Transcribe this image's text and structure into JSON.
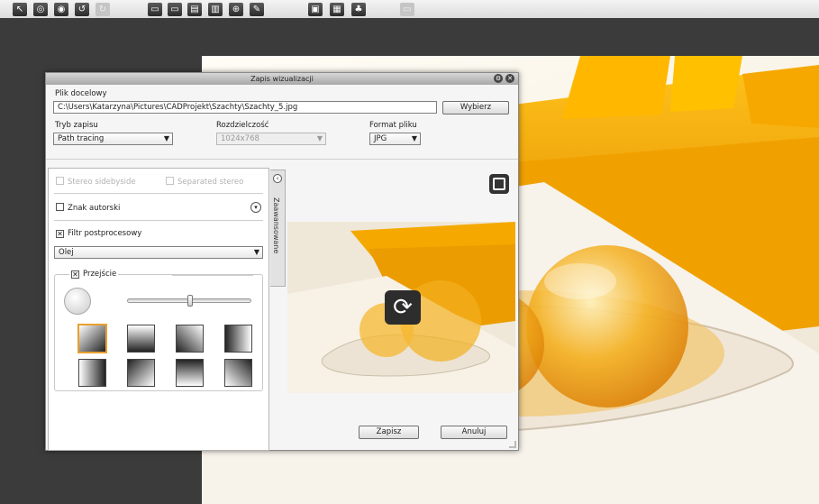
{
  "toolbar": {
    "icons": [
      "select-tool-icon",
      "orbit-icon",
      "view-eye-icon",
      "undo-icon",
      "redo-icon",
      "save-icon",
      "save-as-icon",
      "open-icon",
      "print-icon",
      "web-icon",
      "edit-icon",
      "view-3d-icon",
      "wall-view-icon",
      "plant-icon",
      "screen-icon"
    ]
  },
  "dialog": {
    "title": "Zapis wizualizacji",
    "target_label": "Plik docelowy",
    "target_path": "C:\\Users\\Katarzyna\\Pictures\\CADProjekt\\Szachty\\Szachty_5.jpg",
    "choose_label": "Wybierz",
    "mode_label": "Tryb zapisu",
    "mode_value": "Path tracing",
    "resolution_label": "Rozdzielczość",
    "resolution_value": "1024x768",
    "format_label": "Format pliku",
    "format_value": "JPG",
    "advanced_tab": "Zaawansowane",
    "stereo_label": "Stereo sidebyside",
    "separated_label": "Separated stereo",
    "watermark_label": "Znak autorski",
    "filter_label": "Filtr postprocesowy",
    "filter_checked": "✕",
    "filter_value": "Olej",
    "transition_label": "Przejście",
    "transition_checked": "✕",
    "slider_level": 0.5,
    "save_label": "Zapisz",
    "cancel_label": "Anuluj"
  },
  "colors": {
    "sofa": "#f0a400",
    "accent_selected": "#e8a030"
  }
}
